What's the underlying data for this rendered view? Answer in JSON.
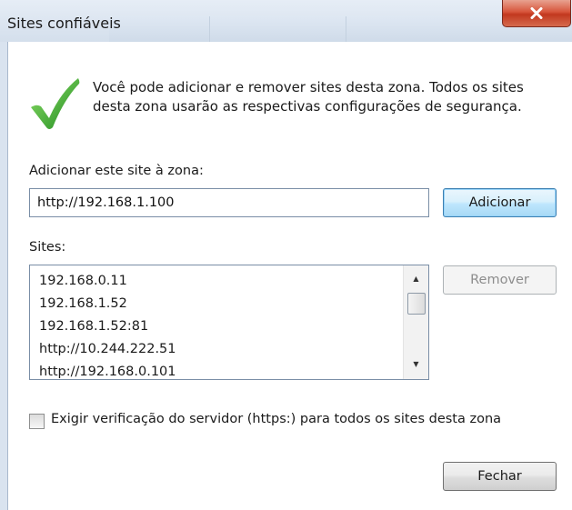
{
  "window": {
    "title": "Sites confiáveis",
    "close_icon": "close-x-icon"
  },
  "info": {
    "icon": "checkmark-icon",
    "text": "Você pode adicionar e remover sites desta zona. Todos os sites desta zona usarão as respectivas configurações de segurança."
  },
  "add_site": {
    "label": "Adicionar este site à zona:",
    "value": "http://192.168.1.100",
    "button_label": "Adicionar"
  },
  "sites": {
    "label": "Sites:",
    "items": [
      "192.168.0.11",
      "192.168.1.52",
      "192.168.1.52:81",
      "http://10.244.222.51",
      "http://192.168.0.101"
    ],
    "remove_label": "Remover"
  },
  "https_option": {
    "label": "Exigir verificação do servidor (https:) para todos os sites desta zona",
    "checked": false
  },
  "close_label": "Fechar",
  "colors": {
    "close_button": "#c2381f",
    "default_button_border": "#3c7fb1",
    "check_green": "#3aa32e"
  }
}
